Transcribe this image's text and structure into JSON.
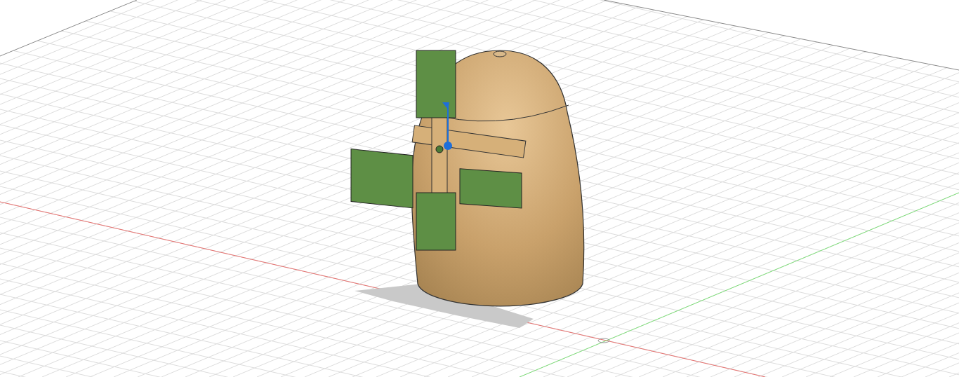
{
  "viewport": {
    "axes": [
      {
        "kind": "x",
        "color": "#e8706e"
      },
      {
        "kind": "y",
        "color": "#7fe07a"
      }
    ]
  }
}
